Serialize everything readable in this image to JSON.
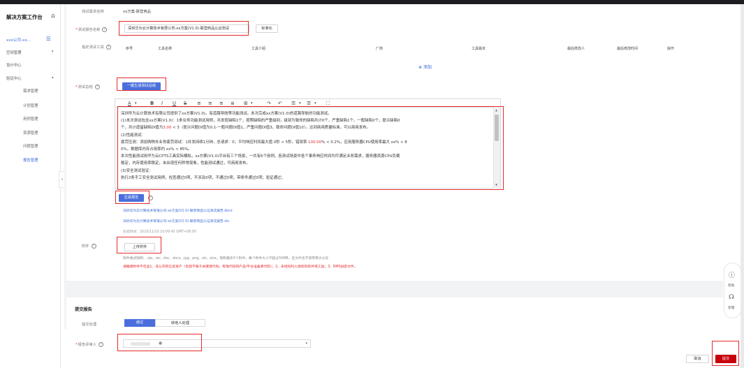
{
  "sidebar": {
    "title": "解决方案工作台",
    "org": "xxx公司-xx...",
    "items": [
      {
        "label": "空间管理",
        "arrow": "▾"
      },
      {
        "label": "设计中心",
        "arrow": ""
      },
      {
        "label": "验证中心",
        "arrow": "▴"
      }
    ],
    "sub_items": [
      {
        "label": "需求管理",
        "active": false
      },
      {
        "label": "计划管理",
        "active": false
      },
      {
        "label": "用例管理",
        "active": false
      },
      {
        "label": "资源管理",
        "active": false
      },
      {
        "label": "问题管理",
        "active": false
      },
      {
        "label": "报告管理",
        "active": true
      }
    ]
  },
  "form": {
    "requirement_label": "测试需求名称",
    "requirement_value": "xx方案-联营商品",
    "report_name_label": "测试报告名称",
    "report_name_value": "深圳华为云计算技术有限公司-xx方案(V1.0)-联营商品认证测试",
    "standardize_button": "标准化",
    "tools_label": "指定测试工具",
    "table_headers": [
      "序号",
      "工具名称",
      "工具介绍",
      "厂商",
      "工具版本",
      "最后修改人",
      "最后修改时间",
      "操作"
    ],
    "add_link": "添加",
    "summary_label": "测试总结",
    "generate_summary_button": "一键生成测试总结",
    "editor_lines": [
      {
        "t": "深圳华为云计算技术有限公司提供了xx方案(V1.0)，有道路导航等功能测试。本次完成xx方案(V1.0)的道路导航的功能测试。"
      },
      {
        "t": "(1)本次测试包含xx方案(V1.0)：1条业务功能测试用例，共发现缺陷1个，按照缺陷的严重级别，级别为致命的缺陷共计0个，严重缺陷1个，一般缺陷0个，提示缺陷0"
      },
      {
        "a": "个，共计遗留缺陷DI值为",
        "h": "3.00",
        "b": " < 3（提示问题DI值为0.1-一般问题DI值1，严重问题DI值3，致命问题DI值10）。达到商用质量标准，可以商用发布。"
      },
      {
        "t": "(2)性能测试："
      },
      {
        "a": "疲劳压测：添加购物车业务疲劳测试：1并发持续1分钟，总请求：0；平均响应时间最大值 0秒 < 5秒，错误率 ",
        "h": "100.00",
        "b": "% < 0.2%，应用服务器CPU使用率最大 xx% < 8"
      },
      {
        "t": "0%，数据库内存占用率约 xx% < 85%。"
      },
      {
        "t": "本次性能测试用华为云CPTS工具实际模拟，xx方案(V1.0)平台有三个场景，一共有6个用例。各测试场景中各个事务响应时间均可满足业务需求，服务器资源CPU负载"
      },
      {
        "t": "稳定，内存使用率稳定，未出现任何异常现象，性能测试通过，可商用发布。"
      },
      {
        "t": "(3)安全测试验证："
      },
      {
        "t": "执行2条手工安全测试用例，检查通过0项，不涉及0项，不通过0项，带条件通过0项；验证通过；"
      }
    ],
    "generate_report_button": "生成报告",
    "report_files": [
      "深圳华为云计算技术有限公司-xx方案(V1.0)-联营商品认证测试报告.docx",
      "深圳华为云计算技术有限公司-xx方案(V1.0)-联营商品认证测试报告.xls"
    ],
    "generated_time": "生成时间：2023/11/10 10:09:45 GMT+08:00",
    "attachment_label": "附件",
    "upload_button": "上传附件",
    "attachment_note": "附件格式限制：.zip, .rar, .doc, .docx, .jpg, .png, .xls, .xlsx，限制最多5个附件，每个附件大小不超过50MB，且文件名不得带英文分号",
    "attachment_warning": "请确保附件不包含1、非公开的信息资产（包括不限于关键源代码、有限代码和产品/平台设备源代码）；2、未经权利人授权的软件或工具；3、RMS加密文件。"
  },
  "submit": {
    "title": "提交报告",
    "handling_label": "提交处理",
    "options": [
      "通过",
      "转他人处理"
    ],
    "reviewer_label": "报告评审人"
  },
  "footer": {
    "cancel": "取消",
    "submit": "提交"
  },
  "float_panel": {
    "help": "帮助",
    "service": "客服"
  },
  "colors": {
    "primary": "#4a6fdc",
    "annotation_red": "#e52b2b",
    "submit_red": "#c7000b"
  }
}
